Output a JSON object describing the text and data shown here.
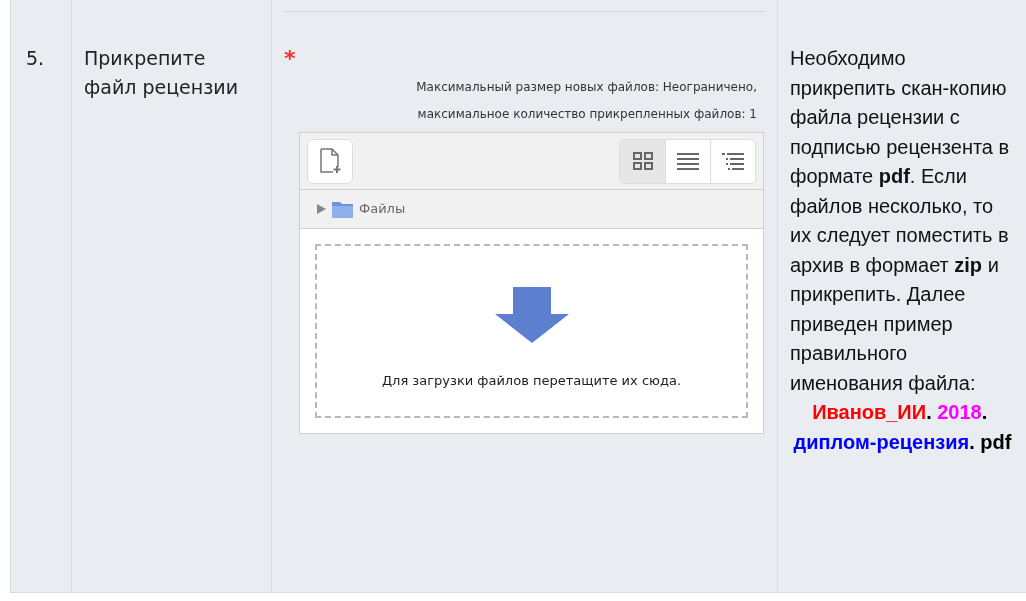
{
  "row": {
    "number": "5.",
    "label": "Прикрепите файл рецензии",
    "required_mark": "*",
    "limits": [
      "Максимальный размер новых файлов: Неограничено,",
      "максимальное количество прикрепленных файлов: 1"
    ],
    "file_picker": {
      "views": [
        {
          "kind": "icons",
          "selected": true
        },
        {
          "kind": "list",
          "selected": false
        },
        {
          "kind": "tree",
          "selected": false
        }
      ],
      "folder": "Файлы",
      "drop_hint": "Для загрузки файлов перетащите их сюда."
    },
    "note": {
      "text": "Необходимо прикрепить скан-копию файла рецензии с подписью рецензента в формате **pdf**. Если файлов несколько, то их следует поместить в архив в формает **zip** и прикрепить. Далее приведен пример правильного именования файла:",
      "example": [
        {
          "text": "Иванов_ИИ",
          "color": "#ff0000"
        },
        {
          "text": ". ",
          "color": "#000000"
        },
        {
          "text": "2018",
          "color": "#ff00ff"
        },
        {
          "text": ". ",
          "color": "#000000"
        },
        {
          "text": "диплом-рецензия",
          "color": "#0000ff"
        },
        {
          "text": ". pdf",
          "color": "#000000"
        }
      ]
    }
  }
}
